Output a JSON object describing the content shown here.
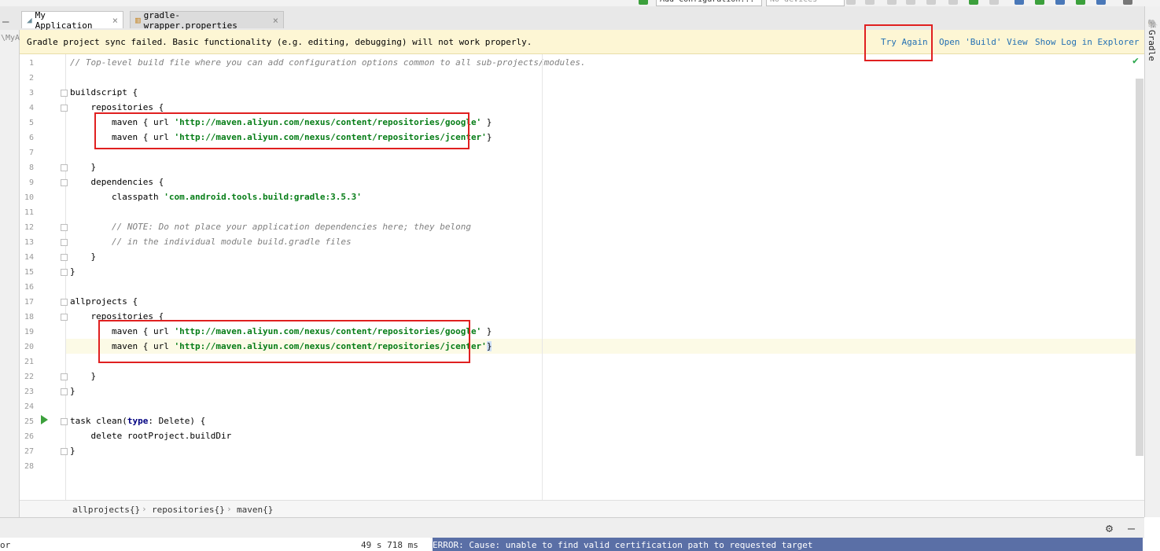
{
  "toolbar": {
    "run_config": "Add Configuration...",
    "device": "No devices"
  },
  "tabs": [
    {
      "label": "My Application",
      "active": true
    },
    {
      "label": "gradle-wrapper.properties",
      "active": false
    }
  ],
  "left_strip": {
    "path_fragment": "\\MyA"
  },
  "right_strip": {
    "label": "Gradle"
  },
  "banner": {
    "message": "Gradle project sync failed. Basic functionality (e.g. editing, debugging) will not work properly.",
    "try_again": "Try Again",
    "open_build": "Open 'Build' View",
    "show_log": "Show Log in Explorer"
  },
  "editor": {
    "lines": [
      "1",
      "2",
      "3",
      "4",
      "5",
      "6",
      "7",
      "8",
      "9",
      "10",
      "11",
      "12",
      "13",
      "14",
      "15",
      "16",
      "17",
      "18",
      "19",
      "20",
      "21",
      "22",
      "23",
      "24",
      "25",
      "26",
      "27",
      "28"
    ],
    "code": {
      "l1": "// Top-level build file where you can add configuration options common to all sub-projects/modules.",
      "l3": "buildscript {",
      "l4": "    repositories {",
      "l5_a": "        maven { url ",
      "l5_s": "'http://maven.aliyun.com/nexus/content/repositories/google'",
      "l5_b": " }",
      "l6_a": "        maven { url ",
      "l6_s": "'http://maven.aliyun.com/nexus/content/repositories/jcenter'",
      "l6_b": "}",
      "l8": "    }",
      "l9": "    dependencies {",
      "l10_a": "        classpath ",
      "l10_s": "'com.android.tools.build:gradle:3.5.3'",
      "l12": "        // NOTE: Do not place your application dependencies here; they belong",
      "l13": "        // in the individual module build.gradle files",
      "l14": "    }",
      "l15": "}",
      "l17": "allprojects {",
      "l18": "    repositories {",
      "l19_a": "        maven { url ",
      "l19_s": "'http://maven.aliyun.com/nexus/content/repositories/google'",
      "l19_b": " }",
      "l20_a": "        maven { url ",
      "l20_s": "'http://maven.aliyun.com/nexus/content/repositories/jcenter'",
      "l20_b": "}",
      "l22": "    }",
      "l23": "}",
      "l25_a": "task clean(",
      "l25_k": "type",
      "l25_b": ": Delete) {",
      "l26": "    delete rootProject.buildDir",
      "l27": "}"
    }
  },
  "breadcrumb": [
    "allprojects{}",
    "repositories{}",
    "maven{}"
  ],
  "bottom": {
    "left_fragment": "or",
    "time": "49 s 718 ms",
    "error": "ERROR: Cause: unable to find valid certification path to requested target"
  },
  "colors": {
    "banner_bg": "#fdf6d4",
    "link": "#2470b3",
    "string": "#067d17",
    "keyword": "#000080",
    "highlight_box": "#e02020",
    "error_bg": "#5a6fa6"
  }
}
